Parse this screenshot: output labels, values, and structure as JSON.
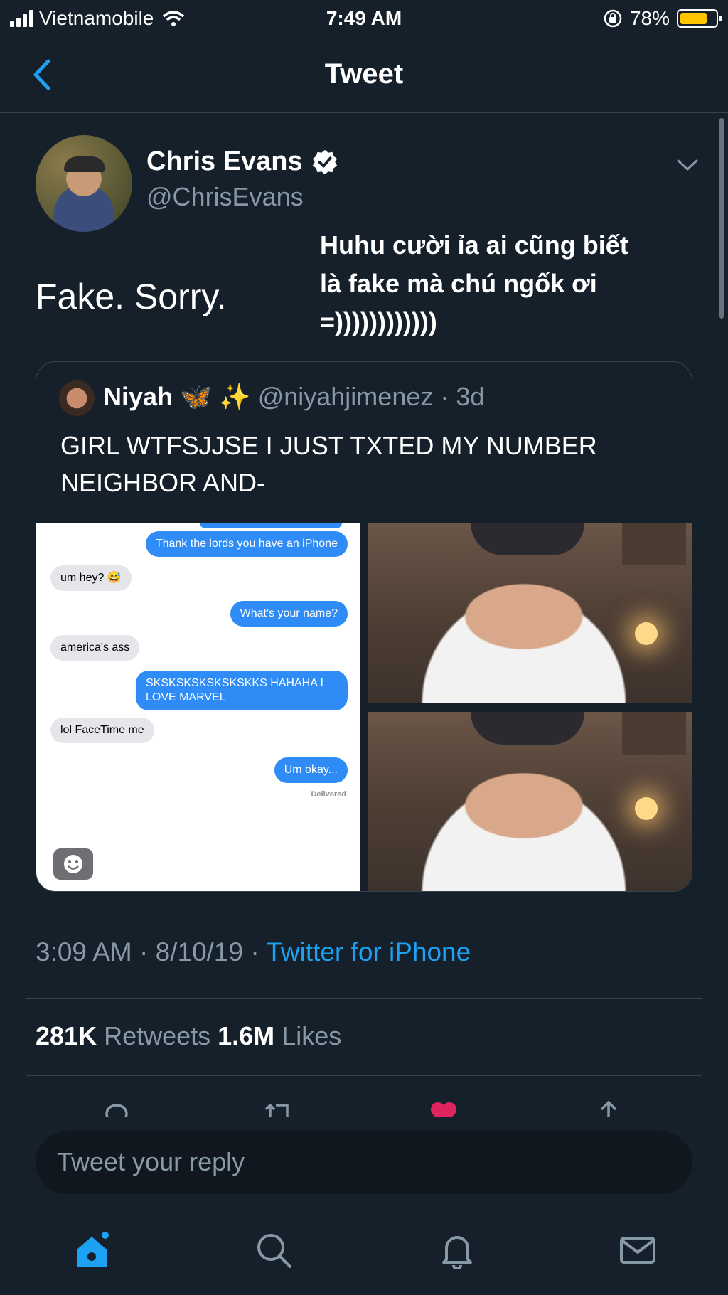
{
  "status_bar": {
    "carrier": "Vietnamobile",
    "time": "7:49 AM",
    "battery": "78%",
    "battery_level": 0.78
  },
  "nav": {
    "title": "Tweet"
  },
  "tweet": {
    "name": "Chris Evans",
    "handle": "@ChrisEvans",
    "text": "Fake. Sorry.",
    "meta_time": "3:09 AM · 8/10/19 · ",
    "meta_source": "Twitter for iPhone",
    "retweets_count": "281K",
    "retweets_label": " Retweets ",
    "likes_count": "1.6M",
    "likes_label": " Likes"
  },
  "overlay_caption": [
    "Huhu cười ỉa ai cũng biết",
    "là fake mà chú ngốk ơi",
    "=))))))))))))"
  ],
  "quote": {
    "name": "Niyah",
    "emoji": "🦋 ✨",
    "handle": "@niyahjimenez · 3d",
    "text": "GIRL WTFSJJSE I JUST TXTED MY NUMBER NEIGHBOR AND-",
    "chat": [
      {
        "from": "out",
        "text": "Thank the lords you have an iPhone"
      },
      {
        "from": "in",
        "text": "um hey? 😅"
      },
      {
        "from": "out",
        "text": "What's your name?"
      },
      {
        "from": "in",
        "text": "america's ass"
      },
      {
        "from": "out",
        "text": "SKSKSKSKSKSKSKKS HAHAHA I LOVE MARVEL"
      },
      {
        "from": "in",
        "text": "lol FaceTime me"
      },
      {
        "from": "out",
        "text": "Um okay..."
      }
    ],
    "delivered": "Delivered"
  },
  "reply": {
    "placeholder": "Tweet your reply"
  },
  "colors": {
    "background": "#15202b",
    "accent": "#1da1f2",
    "like": "#e0245e",
    "muted": "#8899a6"
  },
  "icons": [
    "back-icon",
    "verified-icon",
    "chevron-down-icon",
    "reply-icon",
    "retweet-icon",
    "like-icon",
    "share-icon",
    "home-icon",
    "search-icon",
    "notifications-icon",
    "messages-icon"
  ]
}
